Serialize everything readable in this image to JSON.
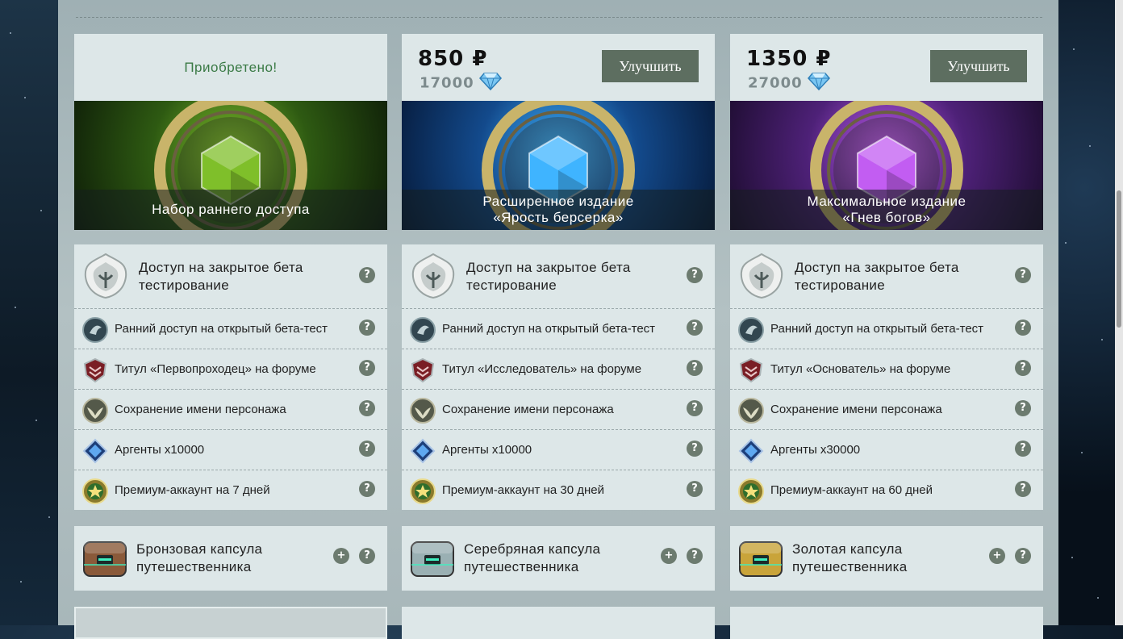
{
  "columns": [
    {
      "acquired_label": "Приобретено!",
      "price_rub": "",
      "price_gems": "",
      "upgrade_label": "",
      "banner_line1": "Набор раннего доступа",
      "banner_line2": "",
      "main_feature": "Доступ на закрытое бета тестирование",
      "features": [
        "Ранний доступ на открытый бета-тест",
        "Титул «Первопроходец» на форуме",
        "Сохранение имени персонажа",
        "Аргенты x10000",
        "Премиум-аккаунт на 7 дней"
      ],
      "capsule": "Бронзовая капсула путешественника"
    },
    {
      "acquired_label": "",
      "price_rub": "850 ₽",
      "price_gems": "17000",
      "upgrade_label": "Улучшить",
      "banner_line1": "Расширенное издание",
      "banner_line2": "«Ярость берсерка»",
      "main_feature": "Доступ на закрытое бета тестирование",
      "features": [
        "Ранний доступ на открытый бета-тест",
        "Титул «Исследователь» на форуме",
        "Сохранение имени персонажа",
        "Аргенты x10000",
        "Премиум-аккаунт на 30 дней"
      ],
      "capsule": "Серебряная капсула путешественника"
    },
    {
      "acquired_label": "",
      "price_rub": "1350 ₽",
      "price_gems": "27000",
      "upgrade_label": "Улучшить",
      "banner_line1": "Максимальное издание",
      "banner_line2": "«Гнев богов»",
      "main_feature": "Доступ на закрытое бета тестирование",
      "features": [
        "Ранний доступ на открытый бета-тест",
        "Титул «Основатель» на форуме",
        "Сохранение имени персонажа",
        "Аргенты x30000",
        "Премиум-аккаунт на 60 дней"
      ],
      "capsule": "Золотая капсула путешественника"
    }
  ],
  "help_glyph": "?",
  "plus_glyph": "+",
  "icons": {
    "main_feature": "crest-icon",
    "features": [
      "dragon-icon",
      "shield-title-icon",
      "wings-emblem-icon",
      "argent-gem-icon",
      "premium-star-icon"
    ],
    "price_gems": "diamond-icon"
  },
  "colors": {
    "acquired": "#3a7a45",
    "button": "#5d6e60",
    "card_bg": "#dde7e8",
    "banner_gems": [
      "#7fbf2a",
      "#3fb4ff",
      "#c25df2"
    ],
    "capsules": [
      "#8a5a3a",
      "#9ab0b3",
      "#c9a43a"
    ]
  }
}
